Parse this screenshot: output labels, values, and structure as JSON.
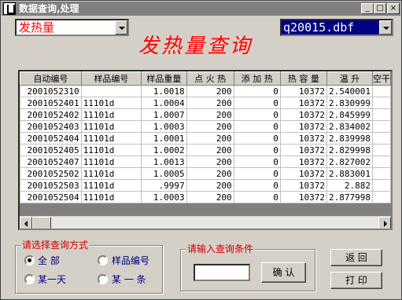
{
  "window": {
    "title": "数据查询,处理"
  },
  "titlebar_buttons": {
    "minimize": "_",
    "maximize": "□",
    "close": "×"
  },
  "query_field_combo": {
    "value": "发热量"
  },
  "file_combo": {
    "value": "q20015.dbf"
  },
  "page_title": "发热量查询",
  "grid": {
    "columns": [
      "自动编号",
      "样品编号",
      "样品重量",
      "点 火 热",
      "添 加 热",
      "热 容 量",
      "温 升",
      "空干"
    ],
    "rows": [
      [
        "2001052310",
        "",
        "1.0018",
        "200",
        "0",
        "10372",
        "2.540001"
      ],
      [
        "2001052401",
        "11101d",
        "1.0004",
        "200",
        "0",
        "10372",
        "2.830999"
      ],
      [
        "2001052402",
        "11101d",
        "1.0007",
        "200",
        "0",
        "10372",
        "2.845999"
      ],
      [
        "2001052403",
        "11101d",
        "1.0003",
        "200",
        "0",
        "10372",
        "2.834002"
      ],
      [
        "2001052404",
        "11101d",
        "1.0001",
        "200",
        "0",
        "10372",
        "2.839998"
      ],
      [
        "2001052405",
        "11101d",
        "1.0002",
        "200",
        "0",
        "10372",
        "2.829998"
      ],
      [
        "2001052407",
        "11101d",
        "1.0013",
        "200",
        "0",
        "10372",
        "2.827002"
      ],
      [
        "2001052502",
        "11101d",
        "1.0005",
        "200",
        "0",
        "10372",
        "2.883001"
      ],
      [
        "2001052503",
        "11101d",
        ".9997",
        "200",
        "0",
        "10372",
        "2.882"
      ],
      [
        "2001052504",
        "11101d",
        "1.0003",
        "200",
        "0",
        "10372",
        "2.877998"
      ]
    ]
  },
  "query_mode_group": {
    "title": "请选择查询方式",
    "options": {
      "all": "全 部",
      "sample_no": "样品编号",
      "one_day": "某一天",
      "one_record": "某 一 条"
    },
    "selected": "all"
  },
  "condition_group": {
    "title": "请输入查询条件",
    "input_value": "",
    "confirm_label": "确 认"
  },
  "buttons": {
    "back": "返 回",
    "print": "打 印"
  }
}
